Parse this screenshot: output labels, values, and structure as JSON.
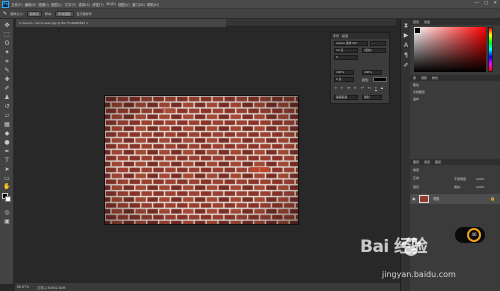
{
  "menubar": {
    "logo": "Ps",
    "items": [
      "文件(F)",
      "编辑(E)",
      "图像(I)",
      "图层(L)",
      "文字(Y)",
      "选择(S)",
      "滤镜(T)",
      "3D(D)",
      "视图(V)",
      "窗口(W)",
      "帮助(H)"
    ],
    "window_controls": [
      "—",
      "▢",
      "✕"
    ]
  },
  "optionsbar": {
    "sample_size_label": "取样大小:",
    "sample_size_value": "取样点",
    "sample_label": "样本:",
    "sample_value": "所有图层",
    "show_ring": "显示取样环"
  },
  "document": {
    "tab_title": "C:\\Users\\...\\brick-wall.jpg @ 66.7%(RGB/8#) ×"
  },
  "status": {
    "zoom": "66.67%",
    "doc_size": "文档:2.64M/2.64M"
  },
  "character_panel": {
    "tabs": [
      "字符",
      "段落"
    ],
    "font_family": "Adobe 黑体 Std",
    "font_style": "-",
    "size": "12 点",
    "leading": "(自动)",
    "tracking": "0",
    "scale_v": "100%",
    "scale_h": "100%",
    "baseline": "0 点",
    "color_label": "颜色:",
    "styles": [
      "T",
      "T",
      "TT",
      "Tr",
      "T¹",
      "T₁",
      "T",
      "T"
    ],
    "language": "美国英语",
    "aa": "锐利"
  },
  "right_panel": {
    "color_tabs": [
      "颜色",
      "色板"
    ],
    "adjust_tabs": [
      "库",
      "调整",
      "样式"
    ],
    "properties_title": "属性",
    "properties_items": [
      "文档属性",
      "画布",
      "图层"
    ],
    "layers_tabs": [
      "图层",
      "通道",
      "路径"
    ],
    "layer_filter": "类型",
    "layer_mode": "正常",
    "opacity_label": "不透明度:",
    "opacity": "100%",
    "lock_label": "锁定:",
    "fill_label": "填充:",
    "fill": "100%",
    "layer_name": "背景"
  },
  "badge": {
    "value": "46"
  },
  "watermark": {
    "logo": "Bai 经验",
    "url": "jingyan.baidu.com"
  },
  "colors": {
    "workspace": "#282828",
    "panel": "#3b3b3b",
    "brick": "#8e3a2e",
    "mortar": "#e8e4de",
    "badge_ring": "#f0a020"
  }
}
